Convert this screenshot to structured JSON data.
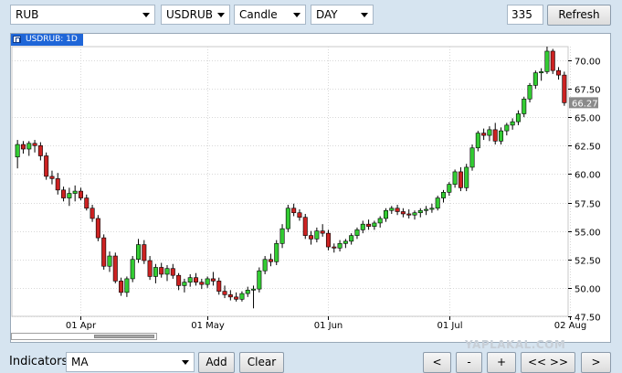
{
  "toolbar": {
    "market": "RUB",
    "symbol": "USDRUB",
    "chart_style": "Candle",
    "interval": "DAY",
    "bar_count": "335",
    "refresh_label": "Refresh"
  },
  "chart": {
    "tab_label": "USDRUB: 1D",
    "last_price_label": "66.27",
    "watermark": "YAPLAKAL.COM"
  },
  "bottom": {
    "indicators_label": "Indicators",
    "indicator_value": "MA",
    "add_label": "Add",
    "clear_label": "Clear",
    "nav_prev": "<",
    "zoom_out": "-",
    "zoom_in": "+",
    "nav_both": "<< >>",
    "nav_next": ">"
  },
  "colors": {
    "up": "#33cc33",
    "down": "#cc2222",
    "tab": "#1f66d8",
    "last_price_bg": "#8a8a8a"
  },
  "chart_data": {
    "type": "candlestick",
    "y_ticks": [
      "70.00",
      "67.50",
      "65.00",
      "62.50",
      "60.00",
      "57.50",
      "55.00",
      "52.50",
      "50.00",
      "47.50"
    ],
    "ylim": [
      47.5,
      71.2
    ],
    "x_ticks": [
      "01 Apr",
      "01 May",
      "01 Jun",
      "01 Jul",
      "02 Aug"
    ],
    "x_tick_index": [
      11,
      33,
      54,
      75,
      96
    ],
    "last_price": 66.27,
    "ohlc": [
      [
        61.5,
        63.0,
        60.5,
        62.6
      ],
      [
        62.6,
        62.9,
        61.8,
        62.2
      ],
      [
        62.2,
        62.9,
        61.6,
        62.7
      ],
      [
        62.7,
        63.0,
        61.9,
        62.5
      ],
      [
        62.5,
        62.8,
        61.2,
        61.6
      ],
      [
        61.6,
        61.9,
        59.5,
        59.8
      ],
      [
        59.8,
        60.3,
        59.1,
        59.6
      ],
      [
        59.6,
        60.1,
        58.2,
        58.6
      ],
      [
        58.6,
        58.9,
        57.6,
        57.9
      ],
      [
        57.9,
        58.8,
        57.2,
        58.3
      ],
      [
        58.3,
        59.0,
        57.6,
        58.5
      ],
      [
        58.5,
        58.8,
        57.7,
        57.9
      ],
      [
        57.9,
        58.2,
        56.8,
        57.0
      ],
      [
        57.0,
        57.3,
        55.8,
        56.1
      ],
      [
        56.1,
        56.4,
        54.1,
        54.4
      ],
      [
        54.4,
        54.7,
        51.6,
        51.9
      ],
      [
        51.9,
        53.2,
        51.4,
        52.8
      ],
      [
        52.8,
        53.1,
        50.4,
        50.6
      ],
      [
        50.6,
        50.9,
        49.3,
        49.6
      ],
      [
        49.6,
        51.0,
        49.2,
        50.8
      ],
      [
        50.8,
        52.8,
        50.5,
        52.5
      ],
      [
        52.5,
        54.3,
        52.2,
        53.8
      ],
      [
        53.8,
        54.2,
        52.1,
        52.4
      ],
      [
        52.4,
        52.8,
        50.7,
        51.0
      ],
      [
        51.0,
        52.1,
        50.4,
        51.8
      ],
      [
        51.8,
        52.2,
        50.9,
        51.2
      ],
      [
        51.2,
        52.0,
        50.6,
        51.7
      ],
      [
        51.7,
        52.1,
        50.8,
        51.1
      ],
      [
        51.1,
        51.3,
        49.8,
        50.2
      ],
      [
        50.2,
        50.8,
        49.6,
        50.5
      ],
      [
        50.5,
        51.2,
        50.1,
        50.9
      ],
      [
        50.9,
        51.3,
        50.2,
        50.5
      ],
      [
        50.5,
        50.8,
        49.9,
        50.3
      ],
      [
        50.3,
        51.0,
        50.0,
        50.8
      ],
      [
        50.8,
        51.4,
        50.2,
        50.6
      ],
      [
        50.6,
        50.9,
        49.4,
        49.7
      ],
      [
        49.7,
        50.2,
        49.1,
        49.4
      ],
      [
        49.4,
        49.8,
        48.9,
        49.2
      ],
      [
        49.2,
        49.6,
        48.8,
        49.0
      ],
      [
        49.0,
        49.7,
        48.8,
        49.5
      ],
      [
        49.5,
        50.1,
        49.2,
        49.8
      ],
      [
        49.8,
        50.2,
        48.2,
        49.9
      ],
      [
        49.9,
        51.8,
        49.6,
        51.5
      ],
      [
        51.5,
        52.8,
        51.2,
        52.5
      ],
      [
        52.5,
        53.0,
        51.9,
        52.3
      ],
      [
        52.3,
        54.2,
        52.0,
        53.9
      ],
      [
        53.9,
        55.6,
        53.5,
        55.2
      ],
      [
        55.2,
        57.3,
        54.9,
        57.0
      ],
      [
        57.0,
        57.4,
        56.3,
        56.6
      ],
      [
        56.6,
        56.9,
        55.9,
        56.2
      ],
      [
        56.2,
        56.5,
        54.3,
        54.6
      ],
      [
        54.6,
        55.0,
        53.8,
        54.3
      ],
      [
        54.3,
        55.3,
        54.0,
        55.0
      ],
      [
        55.0,
        55.6,
        54.5,
        54.8
      ],
      [
        54.8,
        55.1,
        53.3,
        53.6
      ],
      [
        53.6,
        53.9,
        53.1,
        53.5
      ],
      [
        53.5,
        54.2,
        53.2,
        53.9
      ],
      [
        53.9,
        54.3,
        53.5,
        54.1
      ],
      [
        54.1,
        54.8,
        53.8,
        54.6
      ],
      [
        54.6,
        55.3,
        54.3,
        55.1
      ],
      [
        55.1,
        55.9,
        54.8,
        55.6
      ],
      [
        55.6,
        56.0,
        55.1,
        55.4
      ],
      [
        55.4,
        55.9,
        55.1,
        55.7
      ],
      [
        55.7,
        56.3,
        55.3,
        56.1
      ],
      [
        56.1,
        57.0,
        55.8,
        56.8
      ],
      [
        56.8,
        57.2,
        56.5,
        57.0
      ],
      [
        57.0,
        57.3,
        56.4,
        56.7
      ],
      [
        56.7,
        57.0,
        56.2,
        56.5
      ],
      [
        56.5,
        56.9,
        56.1,
        56.4
      ],
      [
        56.4,
        56.8,
        56.0,
        56.6
      ],
      [
        56.6,
        57.0,
        56.2,
        56.8
      ],
      [
        56.8,
        57.2,
        56.4,
        56.9
      ],
      [
        56.9,
        57.4,
        56.6,
        57.0
      ],
      [
        57.0,
        58.1,
        56.8,
        57.9
      ],
      [
        57.9,
        58.6,
        57.5,
        58.4
      ],
      [
        58.4,
        59.3,
        58.1,
        59.1
      ],
      [
        59.1,
        60.4,
        58.8,
        60.2
      ],
      [
        60.2,
        60.6,
        58.5,
        58.8
      ],
      [
        58.8,
        60.9,
        58.5,
        60.6
      ],
      [
        60.6,
        62.6,
        60.3,
        62.3
      ],
      [
        62.3,
        63.8,
        62.0,
        63.6
      ],
      [
        63.6,
        64.0,
        63.0,
        63.4
      ],
      [
        63.4,
        64.2,
        62.9,
        63.9
      ],
      [
        63.9,
        64.5,
        62.6,
        62.9
      ],
      [
        62.9,
        64.1,
        62.6,
        63.8
      ],
      [
        63.8,
        64.5,
        63.4,
        64.3
      ],
      [
        64.3,
        64.9,
        63.9,
        64.6
      ],
      [
        64.6,
        65.6,
        64.3,
        65.3
      ],
      [
        65.3,
        66.8,
        65.0,
        66.6
      ],
      [
        66.6,
        68.0,
        66.3,
        67.8
      ],
      [
        67.8,
        69.1,
        67.5,
        68.9
      ],
      [
        68.9,
        69.3,
        68.2,
        69.0
      ],
      [
        69.0,
        71.2,
        68.8,
        70.8
      ],
      [
        70.8,
        71.0,
        68.8,
        69.1
      ],
      [
        69.1,
        69.4,
        68.3,
        68.7
      ],
      [
        68.7,
        69.0,
        66.0,
        66.27
      ]
    ]
  }
}
